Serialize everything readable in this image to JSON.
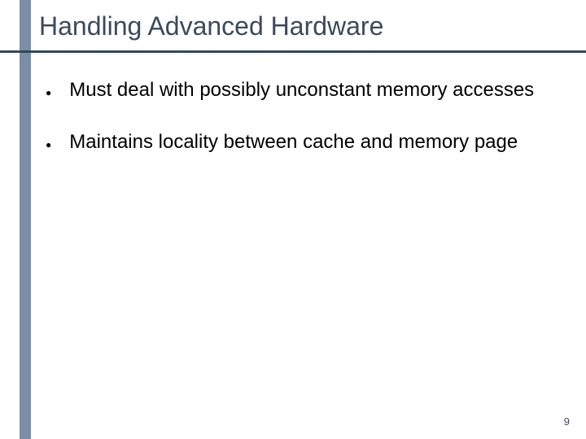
{
  "title": "Handling Advanced Hardware",
  "bullets": [
    {
      "text": "Must deal with possibly unconstant memory accesses"
    },
    {
      "text": "Maintains locality between cache and memory page"
    }
  ],
  "page_number": "9"
}
